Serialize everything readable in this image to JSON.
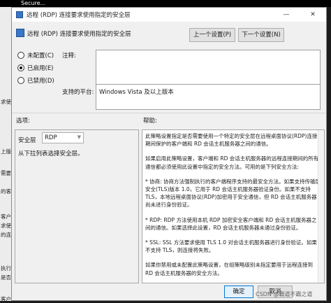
{
  "background": {
    "title": "Secure...",
    "fragments": [
      "求使用",
      "上版本",
      "需要",
      "的客户",
      "客户",
      "求使用",
      "的连接",
      "执行",
      "是否",
      "客户"
    ]
  },
  "dialog": {
    "title": "远程 (RDP) 连接要求使用指定的安全层",
    "min_symbol": "—",
    "close_symbol": "✕",
    "header": "远程 (RDP) 连接要求使用指定的安全层",
    "prev_setting": "上一个设置(P)",
    "next_setting": "下一个设置(N)",
    "radios": [
      {
        "label": "未配置(C)",
        "checked": false
      },
      {
        "label": "已启用(E)",
        "checked": true
      },
      {
        "label": "已禁用(D)",
        "checked": false
      }
    ],
    "comment_label": "注释:",
    "supported_label": "支持的平台:",
    "supported_value": "Windows Vista 及以上版本",
    "options_label": "选项:",
    "help_label": "帮助:",
    "security_layer_label": "安全层",
    "security_layer_value": "RDP",
    "security_layer_desc": "从下拉列表选择安全层。",
    "help_paragraphs": [
      "此策略设置指定是否需要使用一个特定的安全层在远程桌面协议(RDP)连接期间保护的客户端和 RD 会话主机服务器之间的通信。",
      "如果启用此策略设置，客户端和 RD 会话主机服务器的远程连接期间的所有通信都必须使用此设置中指定的安全方法。可用的是下列安全方法:",
      "* 协商: 协商方法强制执行的客户端程序支持的最安全方法。如果支持传输层安全(TLS)版本 1.0，它用于 RD 会话主机服务器验证身份。如果不支持 TLS，本地远程桌面协议(RDP)加密用于安全通信，但 RD 会话主机服务器尚未进行身份验证。",
      "* RDP: RDP 方法使用本机 RDP 加密安全客户端和 RD 会话主机服务器之间的通信。如果选择此设置，RD 会话主机服务器未通过身份验证。",
      "* SSL: SSL 方法要求使用 TLS 1.0 对会话主机服务器进行身份验证。如果不支持 TLS，则连接将失败。",
      "如果你禁用或未配置此策略设置，在组策略级别未指定要用于远程连接到 RD 会话主机服务器的安全方法。"
    ],
    "ok": "确定",
    "cancel": "取消"
  },
  "watermark": "CSDN @霸道不霸之道"
}
